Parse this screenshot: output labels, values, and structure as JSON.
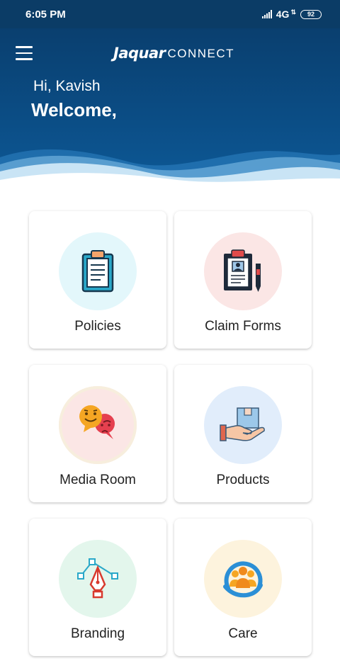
{
  "status_bar": {
    "time": "6:05 PM",
    "network": "4G",
    "battery": "92"
  },
  "header": {
    "logo_part1": "Jaquar",
    "logo_part2": "CONNECT",
    "greeting": "Hi, Kavish",
    "welcome": "Welcome,"
  },
  "tiles": [
    {
      "label": "Policies",
      "icon": "clipboard-document-icon",
      "bg": "#e3f7fb"
    },
    {
      "label": "Claim Forms",
      "icon": "clipboard-form-pen-icon",
      "bg": "#fbe6e5"
    },
    {
      "label": "Media Room",
      "icon": "emotion-chat-bubbles-icon",
      "bg": "#fbe6e5"
    },
    {
      "label": "Products",
      "icon": "hand-holding-box-icon",
      "bg": "#e1edfb"
    },
    {
      "label": "Branding",
      "icon": "pen-tool-vector-icon",
      "bg": "#e3f6ec"
    },
    {
      "label": "Care",
      "icon": "people-care-circle-icon",
      "bg": "#fdf3dd"
    }
  ]
}
